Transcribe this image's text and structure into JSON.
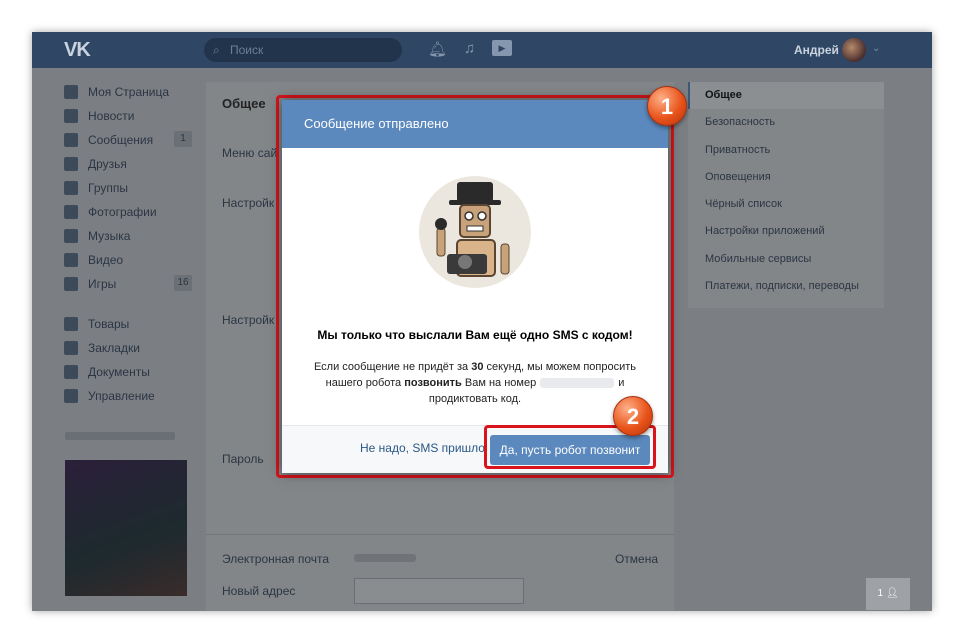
{
  "header": {
    "logo": "VK",
    "search_placeholder": "Поиск",
    "user_name": "Андрей"
  },
  "nav": {
    "items": [
      {
        "label": "Моя Страница",
        "icon": "home-icon"
      },
      {
        "label": "Новости",
        "icon": "news-icon"
      },
      {
        "label": "Сообщения",
        "icon": "messages-icon",
        "badge": "1"
      },
      {
        "label": "Друзья",
        "icon": "friends-icon"
      },
      {
        "label": "Группы",
        "icon": "groups-icon"
      },
      {
        "label": "Фотографии",
        "icon": "photo-icon"
      },
      {
        "label": "Музыка",
        "icon": "music-icon"
      },
      {
        "label": "Видео",
        "icon": "video-icon"
      },
      {
        "label": "Игры",
        "icon": "games-icon",
        "badge": "16"
      }
    ],
    "items2": [
      {
        "label": "Товары",
        "icon": "goods-icon"
      },
      {
        "label": "Закладки",
        "icon": "bookmarks-icon"
      },
      {
        "label": "Документы",
        "icon": "documents-icon"
      },
      {
        "label": "Управление",
        "icon": "manage-icon"
      }
    ]
  },
  "center": {
    "title": "Общее",
    "row_site_menu": "Меню сай",
    "row_settings1": "Настройк",
    "row_settings2": "Настройк",
    "row_password": "Пароль",
    "row_email": "Электронная почта",
    "row_new_address": "Новый адрес",
    "cancel": "Отмена"
  },
  "right_menu": {
    "items": [
      {
        "label": "Общее",
        "active": true
      },
      {
        "label": "Безопасность"
      },
      {
        "label": "Приватность"
      },
      {
        "label": "Оповещения"
      },
      {
        "label": "Чёрный список"
      },
      {
        "label": "Настройки приложений"
      },
      {
        "label": "Мобильные сервисы"
      },
      {
        "label": "Платежи, подписки, переводы"
      }
    ]
  },
  "mini_chat": "1",
  "modal": {
    "title": "Сообщение отправлено",
    "headline": "Мы только что выслали Вам ещё одно SMS с кодом!",
    "text_part1": "Если сообщение не придёт за ",
    "text_seconds": "30",
    "text_part2": " секунд, мы можем попросить нашего робота ",
    "text_call": "позвонить",
    "text_part3": " Вам на номер",
    "text_part4": "и продиктовать код.",
    "cancel_link": "Не надо, SMS пришло",
    "confirm_button": "Да, пусть робот позвонит"
  },
  "markers": {
    "one": "1",
    "two": "2"
  },
  "colors": {
    "accent": "#5b88bd",
    "highlight": "#d9141c",
    "marker": "#e8541a"
  }
}
